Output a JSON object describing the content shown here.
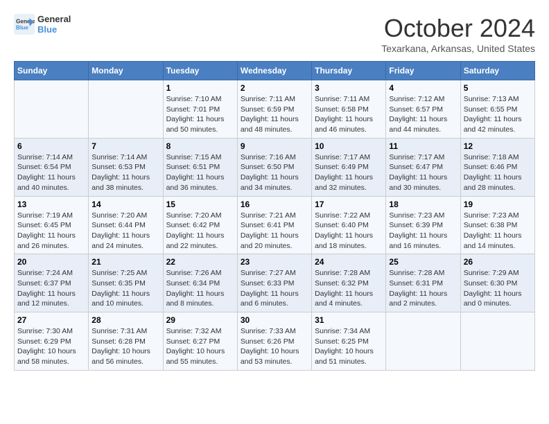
{
  "header": {
    "logo_line1": "General",
    "logo_line2": "Blue",
    "month": "October 2024",
    "location": "Texarkana, Arkansas, United States"
  },
  "weekdays": [
    "Sunday",
    "Monday",
    "Tuesday",
    "Wednesday",
    "Thursday",
    "Friday",
    "Saturday"
  ],
  "weeks": [
    [
      {
        "day": "",
        "sunrise": "",
        "sunset": "",
        "daylight": ""
      },
      {
        "day": "",
        "sunrise": "",
        "sunset": "",
        "daylight": ""
      },
      {
        "day": "1",
        "sunrise": "Sunrise: 7:10 AM",
        "sunset": "Sunset: 7:01 PM",
        "daylight": "Daylight: 11 hours and 50 minutes."
      },
      {
        "day": "2",
        "sunrise": "Sunrise: 7:11 AM",
        "sunset": "Sunset: 6:59 PM",
        "daylight": "Daylight: 11 hours and 48 minutes."
      },
      {
        "day": "3",
        "sunrise": "Sunrise: 7:11 AM",
        "sunset": "Sunset: 6:58 PM",
        "daylight": "Daylight: 11 hours and 46 minutes."
      },
      {
        "day": "4",
        "sunrise": "Sunrise: 7:12 AM",
        "sunset": "Sunset: 6:57 PM",
        "daylight": "Daylight: 11 hours and 44 minutes."
      },
      {
        "day": "5",
        "sunrise": "Sunrise: 7:13 AM",
        "sunset": "Sunset: 6:55 PM",
        "daylight": "Daylight: 11 hours and 42 minutes."
      }
    ],
    [
      {
        "day": "6",
        "sunrise": "Sunrise: 7:14 AM",
        "sunset": "Sunset: 6:54 PM",
        "daylight": "Daylight: 11 hours and 40 minutes."
      },
      {
        "day": "7",
        "sunrise": "Sunrise: 7:14 AM",
        "sunset": "Sunset: 6:53 PM",
        "daylight": "Daylight: 11 hours and 38 minutes."
      },
      {
        "day": "8",
        "sunrise": "Sunrise: 7:15 AM",
        "sunset": "Sunset: 6:51 PM",
        "daylight": "Daylight: 11 hours and 36 minutes."
      },
      {
        "day": "9",
        "sunrise": "Sunrise: 7:16 AM",
        "sunset": "Sunset: 6:50 PM",
        "daylight": "Daylight: 11 hours and 34 minutes."
      },
      {
        "day": "10",
        "sunrise": "Sunrise: 7:17 AM",
        "sunset": "Sunset: 6:49 PM",
        "daylight": "Daylight: 11 hours and 32 minutes."
      },
      {
        "day": "11",
        "sunrise": "Sunrise: 7:17 AM",
        "sunset": "Sunset: 6:47 PM",
        "daylight": "Daylight: 11 hours and 30 minutes."
      },
      {
        "day": "12",
        "sunrise": "Sunrise: 7:18 AM",
        "sunset": "Sunset: 6:46 PM",
        "daylight": "Daylight: 11 hours and 28 minutes."
      }
    ],
    [
      {
        "day": "13",
        "sunrise": "Sunrise: 7:19 AM",
        "sunset": "Sunset: 6:45 PM",
        "daylight": "Daylight: 11 hours and 26 minutes."
      },
      {
        "day": "14",
        "sunrise": "Sunrise: 7:20 AM",
        "sunset": "Sunset: 6:44 PM",
        "daylight": "Daylight: 11 hours and 24 minutes."
      },
      {
        "day": "15",
        "sunrise": "Sunrise: 7:20 AM",
        "sunset": "Sunset: 6:42 PM",
        "daylight": "Daylight: 11 hours and 22 minutes."
      },
      {
        "day": "16",
        "sunrise": "Sunrise: 7:21 AM",
        "sunset": "Sunset: 6:41 PM",
        "daylight": "Daylight: 11 hours and 20 minutes."
      },
      {
        "day": "17",
        "sunrise": "Sunrise: 7:22 AM",
        "sunset": "Sunset: 6:40 PM",
        "daylight": "Daylight: 11 hours and 18 minutes."
      },
      {
        "day": "18",
        "sunrise": "Sunrise: 7:23 AM",
        "sunset": "Sunset: 6:39 PM",
        "daylight": "Daylight: 11 hours and 16 minutes."
      },
      {
        "day": "19",
        "sunrise": "Sunrise: 7:23 AM",
        "sunset": "Sunset: 6:38 PM",
        "daylight": "Daylight: 11 hours and 14 minutes."
      }
    ],
    [
      {
        "day": "20",
        "sunrise": "Sunrise: 7:24 AM",
        "sunset": "Sunset: 6:37 PM",
        "daylight": "Daylight: 11 hours and 12 minutes."
      },
      {
        "day": "21",
        "sunrise": "Sunrise: 7:25 AM",
        "sunset": "Sunset: 6:35 PM",
        "daylight": "Daylight: 11 hours and 10 minutes."
      },
      {
        "day": "22",
        "sunrise": "Sunrise: 7:26 AM",
        "sunset": "Sunset: 6:34 PM",
        "daylight": "Daylight: 11 hours and 8 minutes."
      },
      {
        "day": "23",
        "sunrise": "Sunrise: 7:27 AM",
        "sunset": "Sunset: 6:33 PM",
        "daylight": "Daylight: 11 hours and 6 minutes."
      },
      {
        "day": "24",
        "sunrise": "Sunrise: 7:28 AM",
        "sunset": "Sunset: 6:32 PM",
        "daylight": "Daylight: 11 hours and 4 minutes."
      },
      {
        "day": "25",
        "sunrise": "Sunrise: 7:28 AM",
        "sunset": "Sunset: 6:31 PM",
        "daylight": "Daylight: 11 hours and 2 minutes."
      },
      {
        "day": "26",
        "sunrise": "Sunrise: 7:29 AM",
        "sunset": "Sunset: 6:30 PM",
        "daylight": "Daylight: 11 hours and 0 minutes."
      }
    ],
    [
      {
        "day": "27",
        "sunrise": "Sunrise: 7:30 AM",
        "sunset": "Sunset: 6:29 PM",
        "daylight": "Daylight: 10 hours and 58 minutes."
      },
      {
        "day": "28",
        "sunrise": "Sunrise: 7:31 AM",
        "sunset": "Sunset: 6:28 PM",
        "daylight": "Daylight: 10 hours and 56 minutes."
      },
      {
        "day": "29",
        "sunrise": "Sunrise: 7:32 AM",
        "sunset": "Sunset: 6:27 PM",
        "daylight": "Daylight: 10 hours and 55 minutes."
      },
      {
        "day": "30",
        "sunrise": "Sunrise: 7:33 AM",
        "sunset": "Sunset: 6:26 PM",
        "daylight": "Daylight: 10 hours and 53 minutes."
      },
      {
        "day": "31",
        "sunrise": "Sunrise: 7:34 AM",
        "sunset": "Sunset: 6:25 PM",
        "daylight": "Daylight: 10 hours and 51 minutes."
      },
      {
        "day": "",
        "sunrise": "",
        "sunset": "",
        "daylight": ""
      },
      {
        "day": "",
        "sunrise": "",
        "sunset": "",
        "daylight": ""
      }
    ]
  ]
}
